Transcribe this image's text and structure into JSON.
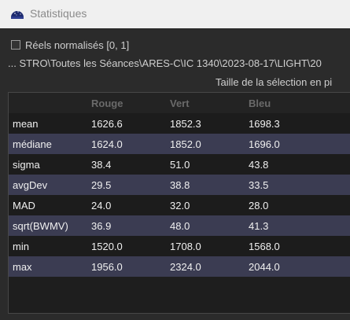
{
  "window": {
    "title": "Statistiques"
  },
  "options": {
    "normalized_label": "Réels normalisés [0, 1]",
    "normalized_checked": false
  },
  "path": "... STRO\\Toutes les Séances\\ARES-C\\IC 1340\\2023-08-17\\LIGHT\\20",
  "selection_size_label": "Taille de la sélection en pi",
  "table": {
    "columns": [
      "",
      "Rouge",
      "Vert",
      "Bleu"
    ],
    "rows": [
      {
        "label": "mean",
        "values": [
          "1626.6",
          "1852.3",
          "1698.3"
        ]
      },
      {
        "label": "médiane",
        "values": [
          "1624.0",
          "1852.0",
          "1696.0"
        ]
      },
      {
        "label": "sigma",
        "values": [
          "38.4",
          "51.0",
          "43.8"
        ]
      },
      {
        "label": "avgDev",
        "values": [
          "29.5",
          "38.8",
          "33.5"
        ]
      },
      {
        "label": "MAD",
        "values": [
          "24.0",
          "32.0",
          "28.0"
        ]
      },
      {
        "label": "sqrt(BWMV)",
        "values": [
          "36.9",
          "48.0",
          "41.3"
        ]
      },
      {
        "label": "min",
        "values": [
          "1520.0",
          "1708.0",
          "1568.0"
        ]
      },
      {
        "label": "max",
        "values": [
          "1956.0",
          "2324.0",
          "2044.0"
        ]
      }
    ]
  },
  "icons": {
    "app": "sky-app-icon"
  },
  "colors": {
    "row_alt": "#3b3c52",
    "row_dark": "#1c1c1c",
    "header_text": "#6a6a6a"
  }
}
